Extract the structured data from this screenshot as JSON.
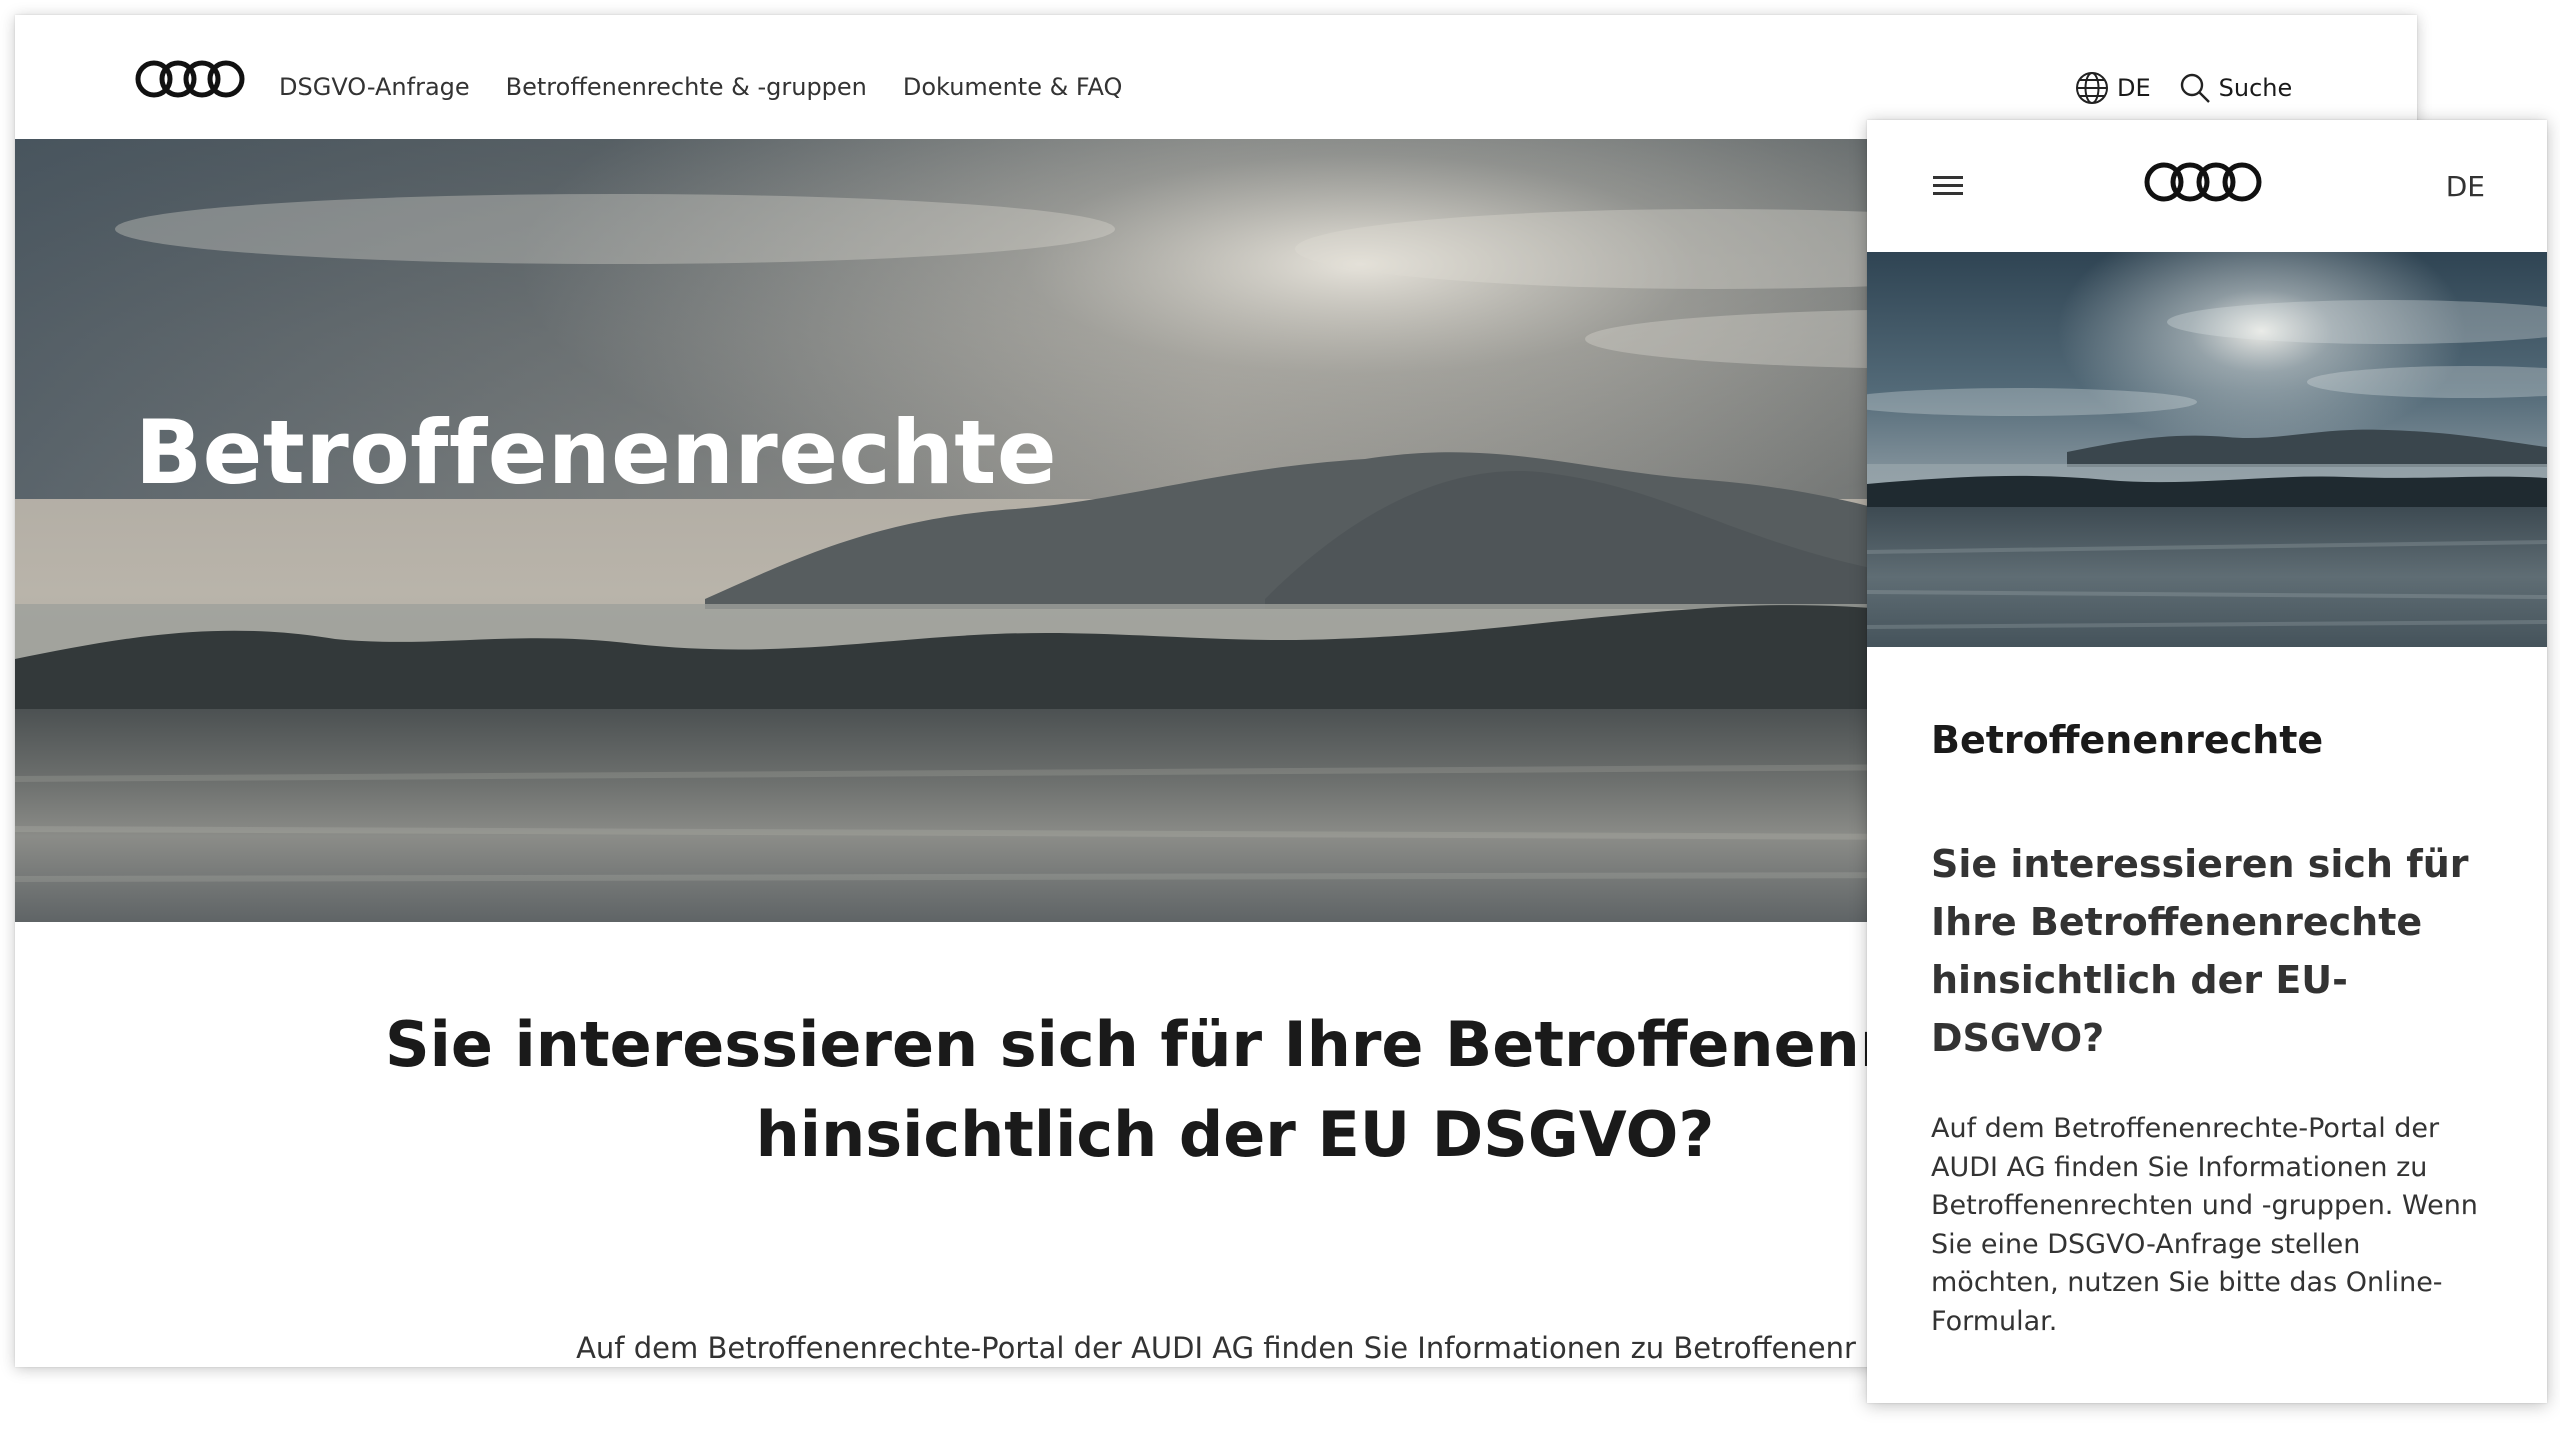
{
  "desktop": {
    "brand": "Audi",
    "nav": [
      {
        "label": "DSGVO-Anfrage"
      },
      {
        "label": "Betroffenenrechte & -gruppen"
      },
      {
        "label": "Dokumente & FAQ"
      }
    ],
    "language_label": "DE",
    "search_label": "Suche",
    "hero_title": "Betroffenenrechte",
    "question": "Sie interessieren sich für Ihre Betroffenenrechte hinsichtlich der EU DSGVO?",
    "intro": "Auf dem Betroffenenrechte-Portal der AUDI AG finden Sie Informationen zu Betroffenenr"
  },
  "mobile": {
    "language_label": "DE",
    "hero_title": "Betroffenenrechte",
    "question": "Sie interessieren sich für Ihre Betroffenenrechte hinsichtlich der EU-DSGVO?",
    "intro": "Auf dem Betroffenenrechte-Portal der AUDI AG finden Sie Informationen zu Betroffenenrechten und -gruppen. Wenn Sie eine DSGVO-Anfrage stellen möchten, nutzen Sie bitte das Online-Formular."
  },
  "icons": {
    "logo": "audi-rings-icon",
    "language": "globe-icon",
    "search": "search-icon",
    "menu": "hamburger-menu-icon"
  }
}
